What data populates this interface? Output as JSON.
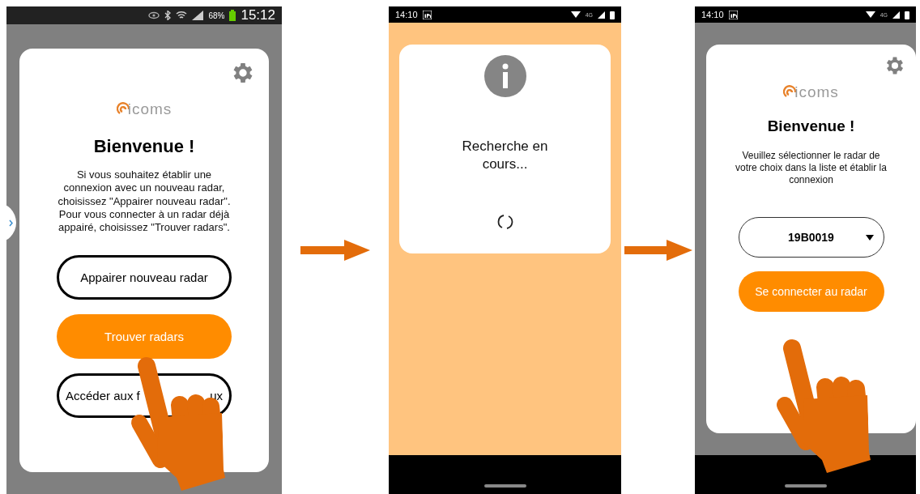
{
  "screens": [
    {
      "kind": "welcome",
      "status_bar": {
        "kind": "legacy",
        "battery": "68%",
        "time": "15:12"
      },
      "card": {
        "logo": "icoms",
        "title": "Bienvenue !",
        "message": "Si vous souhaitez établir une connexion avec un nouveau radar, choisissez \"Appairer nouveau radar\". Pour vous connecter à un radar déjà appairé, choisissez \"Trouver radars\".",
        "buttons": [
          {
            "kind": "outline",
            "label": "Appairer nouveau radar"
          },
          {
            "kind": "primary",
            "label": "Trouver radars"
          },
          {
            "kind": "outline",
            "label": "Accéder aux f",
            "label_tail": "ux"
          }
        ]
      }
    },
    {
      "kind": "loading",
      "status_bar": {
        "kind": "modern",
        "network": "4G",
        "time": "14:10"
      },
      "card": {
        "message": "Recherche en cours..."
      }
    },
    {
      "kind": "select",
      "status_bar": {
        "kind": "modern",
        "network": "4G",
        "time": "14:10"
      },
      "card": {
        "logo": "icoms",
        "title": "Bienvenue !",
        "message": "Veuillez sélectionner le radar de votre choix dans la liste et établir la connexion",
        "select": {
          "value": "19B0019"
        },
        "button": {
          "kind": "primary",
          "label": "Se connecter au radar"
        }
      }
    }
  ]
}
